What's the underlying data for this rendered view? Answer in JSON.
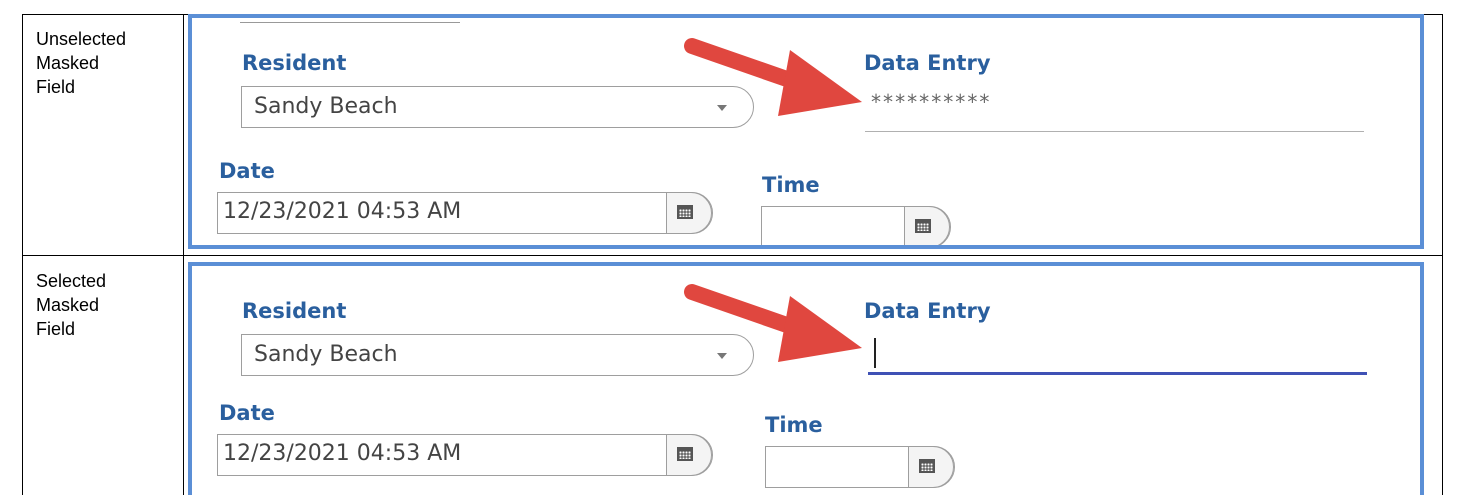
{
  "rows": [
    {
      "label": [
        "Unselected",
        "Masked",
        "Field"
      ],
      "resident_title": "Resident",
      "resident_value": "Sandy Beach",
      "data_entry_title": "Data Entry",
      "data_entry_value": "**********",
      "date_title": "Date",
      "date_value": "12/23/2021 04:53 AM",
      "time_title": "Time",
      "time_value": ""
    },
    {
      "label": [
        "Selected",
        "Masked",
        "Field"
      ],
      "resident_title": "Resident",
      "resident_value": "Sandy Beach",
      "data_entry_title": "Data Entry",
      "data_entry_value": "",
      "date_title": "Date",
      "date_value": "12/23/2021 04:53 AM",
      "time_title": "Time",
      "time_value": ""
    }
  ],
  "icons": {
    "dropdown": "chevron-down-icon",
    "calendar": "calendar-icon",
    "annotation": "red-arrow-icon"
  },
  "colors": {
    "panel_border": "#5b8fd6",
    "field_title": "#2a5f9e",
    "active_underline": "#3f51b5",
    "arrow": "#e0473f"
  }
}
